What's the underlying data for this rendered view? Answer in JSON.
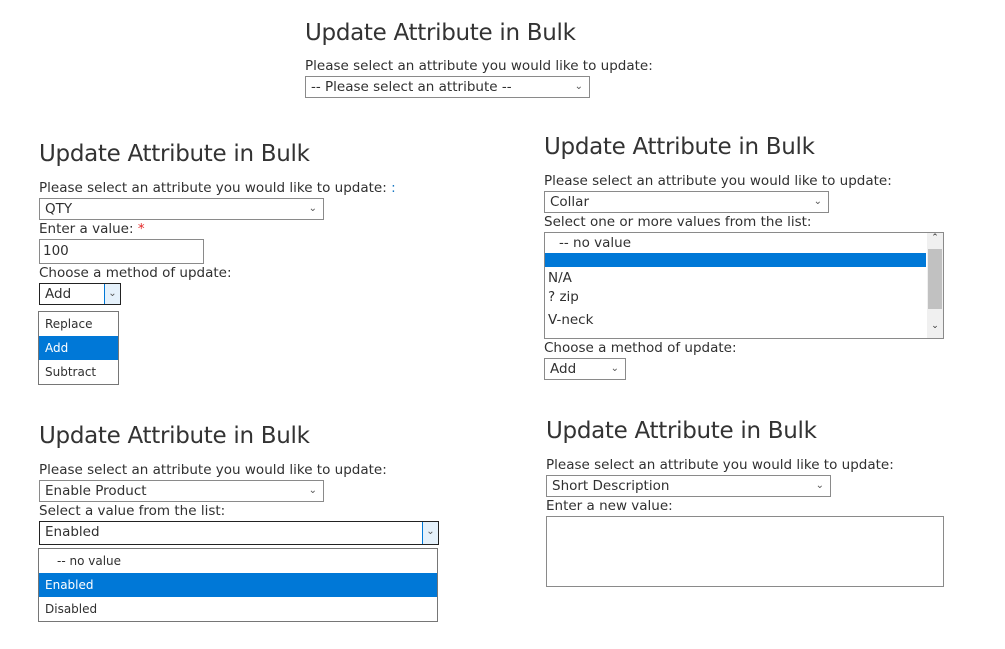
{
  "title": "Update Attribute in Bulk",
  "select_prompt": "Please select an attribute you would like to update:",
  "p1": {
    "selected": "-- Please select an attribute --"
  },
  "p2": {
    "selected": "QTY",
    "colon_hint": ":",
    "value_label": "Enter a value:",
    "required_mark": "*",
    "value": "100",
    "method_label": "Choose a method of update:",
    "method": "Add",
    "options": [
      "Replace",
      "Add",
      "Subtract"
    ]
  },
  "p3": {
    "selected": "Collar",
    "list_label": "Select one or more values from the list:",
    "options": [
      "-- no value",
      "",
      "N/A",
      "? zip",
      "V-neck"
    ],
    "method_label": "Choose a method of update:",
    "method": "Add"
  },
  "p4": {
    "selected": "Enable Product",
    "list_label": "Select a value from the list:",
    "value": "Enabled",
    "options": [
      "-- no value",
      "Enabled",
      "Disabled"
    ]
  },
  "p5": {
    "selected": "Short Description",
    "value_label": "Enter a new value:",
    "value": ""
  },
  "colors": {
    "highlight": "#0078d7",
    "required": "#e22626"
  }
}
